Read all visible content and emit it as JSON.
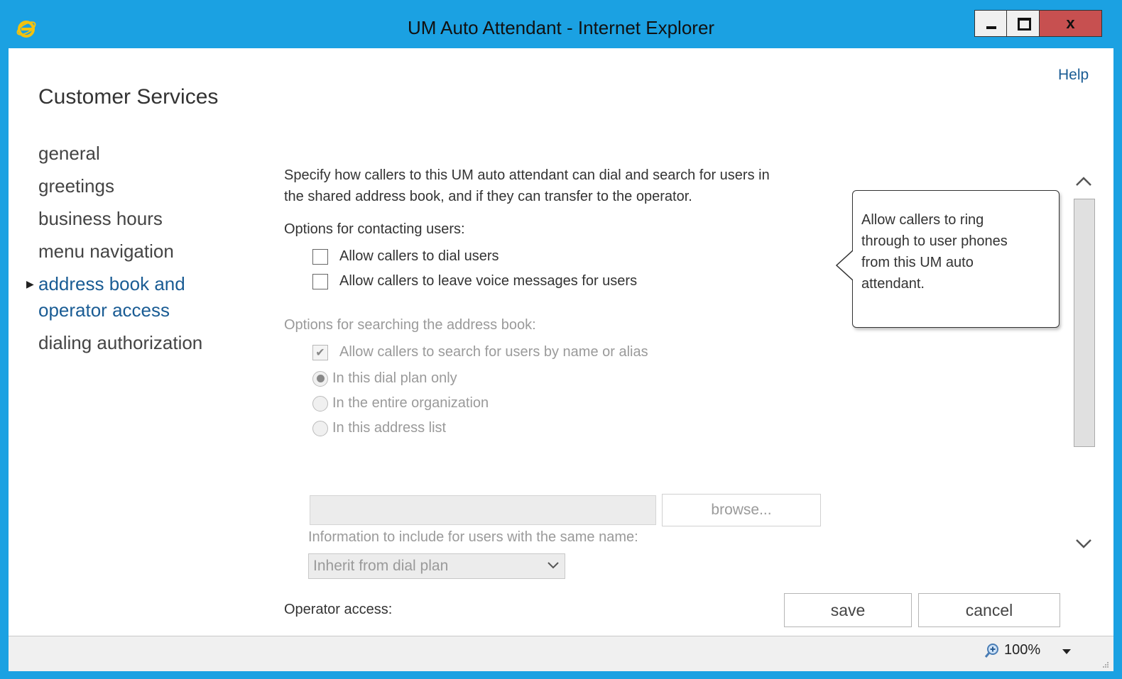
{
  "window": {
    "title": "UM Auto Attendant - Internet Explorer",
    "close_label": "x",
    "accent_color": "#1ba1e2",
    "close_color": "#c75050"
  },
  "page": {
    "help_label": "Help",
    "title": "Customer Services"
  },
  "nav": {
    "items": [
      {
        "label": "general"
      },
      {
        "label": "greetings"
      },
      {
        "label": "business hours"
      },
      {
        "label": "menu navigation"
      },
      {
        "label": "address book and operator access",
        "active": true
      },
      {
        "label": "dialing authorization"
      }
    ],
    "active_line1": "address book and",
    "active_line2": "operator access",
    "active_color": "#1a5c94"
  },
  "content": {
    "intro_line1": "Specify how callers to this UM auto attendant can dial and search for users in",
    "intro_line2": "the shared address book, and if they can transfer to the operator.",
    "contacting_label": "Options for contacting users:",
    "dial_users_label": "Allow callers to dial users",
    "dial_users_checked": false,
    "voice_messages_label": "Allow callers to leave voice messages for users",
    "voice_messages_checked": false,
    "searching_label": "Options for searching the address book:",
    "search_by_name_label": "Allow callers to search for users by name or alias",
    "search_by_name_checked": true,
    "radio_dial_plan": "In this dial plan only",
    "radio_entire_org": "In the entire organization",
    "radio_address_list": "In this address list",
    "selected_scope": "In this dial plan only",
    "address_list_value": "",
    "browse_label": "browse...",
    "same_name_label": "Information to include for users with the same name:",
    "same_name_selected": "Inherit from dial plan",
    "operator_label": "Operator access:"
  },
  "callout": {
    "line1": "Allow callers to ring",
    "line2": "through to user phones",
    "line3": "from this UM auto",
    "line4": "attendant."
  },
  "buttons": {
    "save_label": "save",
    "cancel_label": "cancel"
  },
  "statusbar": {
    "zoom_label": "100%"
  },
  "icons": {
    "logo": "ie-logo-icon",
    "minimize": "minimize-icon",
    "maximize": "maximize-icon",
    "close": "close-icon",
    "scroll_up": "chevron-up-icon",
    "scroll_down": "chevron-down-icon",
    "zoom": "zoom-in-icon",
    "dropdown": "chevron-down-icon",
    "nav_arrow": "triangle-right-icon",
    "checkmark": "checkmark-icon"
  }
}
